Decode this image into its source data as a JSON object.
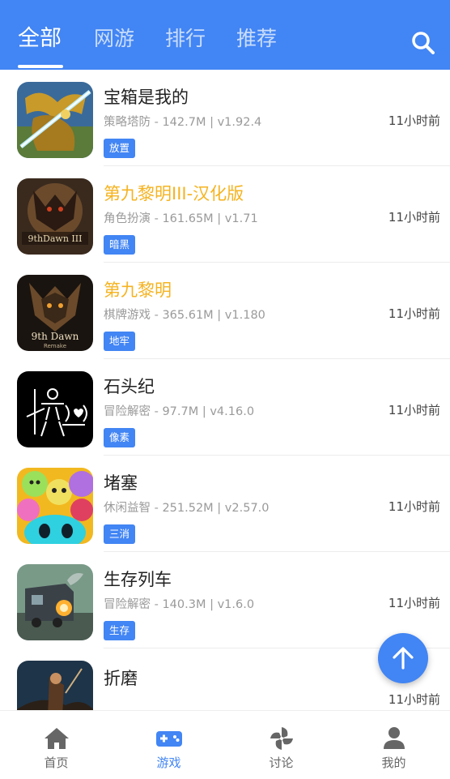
{
  "header": {
    "tabs": [
      {
        "label": "全部",
        "active": true
      },
      {
        "label": "网游",
        "active": false
      },
      {
        "label": "排行",
        "active": false
      },
      {
        "label": "推荐",
        "active": false
      }
    ],
    "search_icon": "search-icon"
  },
  "games": [
    {
      "title": "宝箱是我的",
      "meta": "策略塔防 - 142.7M | v1.92.4",
      "tag": "放置",
      "time": "11小时前",
      "highlight": false
    },
    {
      "title": "第九黎明III-汉化版",
      "meta": "角色扮演 - 161.65M | v1.71",
      "tag": "暗黑",
      "time": "11小时前",
      "highlight": true
    },
    {
      "title": "第九黎明",
      "meta": "棋牌游戏 - 365.61M | v1.180",
      "tag": "地牢",
      "time": "11小时前",
      "highlight": true
    },
    {
      "title": "石头纪",
      "meta": "冒险解密 - 97.7M | v4.16.0",
      "tag": "像素",
      "time": "11小时前",
      "highlight": false
    },
    {
      "title": "堵塞",
      "meta": "休闲益智 - 251.52M | v2.57.0",
      "tag": "三消",
      "time": "11小时前",
      "highlight": false
    },
    {
      "title": "生存列车",
      "meta": "冒险解密 - 140.3M | v1.6.0",
      "tag": "生存",
      "time": "11小时前",
      "highlight": false
    },
    {
      "title": "折磨",
      "meta": "",
      "tag": "",
      "time": "11小时前",
      "highlight": false
    }
  ],
  "icon_text": {
    "dawn3_logo": "9thDawn III",
    "dawn_logo": "9th Dawn",
    "dawn_sub": "Remake"
  },
  "fab": {
    "icon": "arrow-up-icon"
  },
  "bottom_nav": [
    {
      "label": "首页",
      "icon": "home-icon",
      "active": false
    },
    {
      "label": "游戏",
      "icon": "gamepad-icon",
      "active": true
    },
    {
      "label": "讨论",
      "icon": "pinwheel-icon",
      "active": false
    },
    {
      "label": "我的",
      "icon": "user-icon",
      "active": false
    }
  ],
  "colors": {
    "primary": "#4285f4",
    "highlight_title": "#f5b320",
    "meta_text": "#9a9a9a",
    "nav_inactive": "#666666"
  }
}
